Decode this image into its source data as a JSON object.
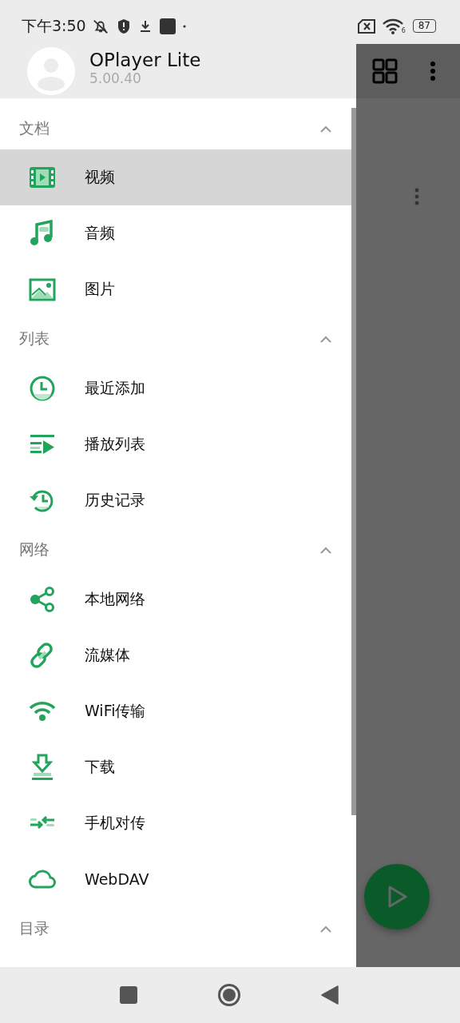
{
  "status_bar": {
    "time": "下午3:50",
    "wifi_label": "6",
    "battery": "87"
  },
  "app": {
    "name": "OPlayer Lite",
    "version": "5.00.40"
  },
  "sections": [
    {
      "title": "文档",
      "expanded": true,
      "items": [
        {
          "label": "视频",
          "kind": "film",
          "selected": true
        },
        {
          "label": "音频",
          "kind": "music",
          "selected": false
        },
        {
          "label": "图片",
          "kind": "image",
          "selected": false
        }
      ]
    },
    {
      "title": "列表",
      "expanded": true,
      "items": [
        {
          "label": "最近添加",
          "kind": "clock",
          "selected": false
        },
        {
          "label": "播放列表",
          "kind": "playlist",
          "selected": false
        },
        {
          "label": "历史记录",
          "kind": "history",
          "selected": false
        }
      ]
    },
    {
      "title": "网络",
      "expanded": true,
      "items": [
        {
          "label": "本地网络",
          "kind": "share",
          "selected": false
        },
        {
          "label": "流媒体",
          "kind": "link",
          "selected": false
        },
        {
          "label": "WiFi传输",
          "kind": "wifi",
          "selected": false
        },
        {
          "label": "下载",
          "kind": "download",
          "selected": false
        },
        {
          "label": "手机对传",
          "kind": "transfer",
          "selected": false
        },
        {
          "label": "WebDAV",
          "kind": "cloud",
          "selected": false
        }
      ]
    },
    {
      "title": "目录",
      "expanded": true
    }
  ]
}
